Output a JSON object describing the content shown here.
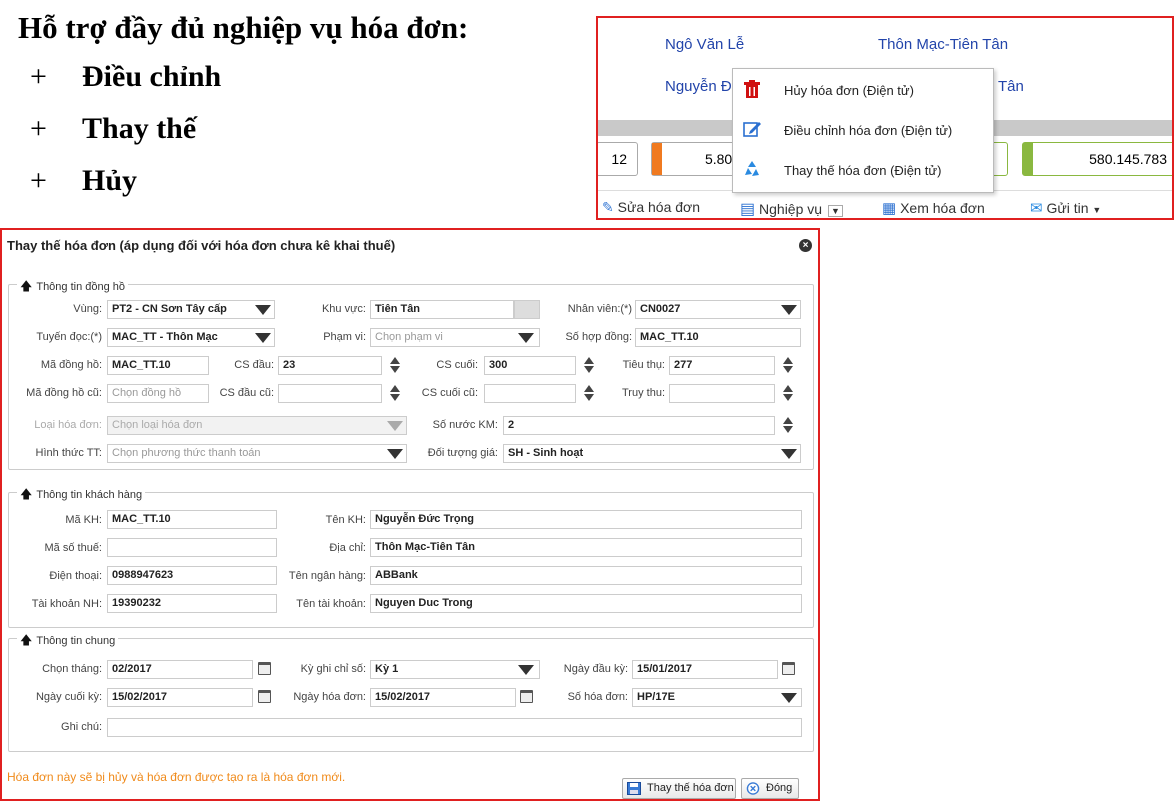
{
  "slide": {
    "heading": "Hỗ trợ đầy đủ nghiệp vụ hóa đơn:",
    "features": [
      "Điều chỉnh",
      "Thay thế",
      "Hủy"
    ],
    "bullet": "+"
  },
  "top_panel": {
    "row1_name": "Ngô Văn Lễ",
    "row1_address": "Thôn Mạc-Tiên Tân",
    "row2_name": "Nguyễn Đ",
    "row2_address": "Tân",
    "box1_value": "12",
    "box2_value": "5.801",
    "box3_value": "580.145.783",
    "toolbar": {
      "edit_label": "Sửa hóa đơn",
      "ops_label": "Nghiệp vụ",
      "view_label": "Xem hóa đơn",
      "send_label": "Gửi tin"
    },
    "menu": {
      "cancel": "Hủy hóa đơn (Điện tử)",
      "adjust": "Điều chỉnh hóa đơn (Điện tử)",
      "replace": "Thay thế hóa đơn (Điện tử)"
    }
  },
  "dialog": {
    "title": "Thay thế hóa đơn (áp dụng đối với hóa đơn chưa kê khai thuế)",
    "meter_section": {
      "legend": "Thông tin đồng hồ",
      "vung_label": "Vùng:",
      "vung_value": "PT2 - CN Sơn Tây cấp",
      "khuvuc_label": "Khu vực:",
      "khuvuc_value": "Tiên Tân",
      "nhanvien_label": "Nhân viên:(*)",
      "nhanvien_value": "CN0027",
      "tuyendoc_label": "Tuyến đọc:(*)",
      "tuyendoc_value": "MAC_TT - Thôn Mạc",
      "phamvi_label": "Phạm vi:",
      "phamvi_placeholder": "Chọn phạm vi",
      "sohopdong_label": "Số hợp đồng:",
      "sohopdong_value": "MAC_TT.10",
      "madongho_label": "Mã đồng hồ:",
      "madongho_value": "MAC_TT.10",
      "csdau_label": "CS đầu:",
      "csdau_value": "23",
      "cscuoi_label": "CS cuối:",
      "cscuoi_value": "300",
      "tieuthu_label": "Tiêu thụ:",
      "tieuthu_value": "277",
      "madonghocu_label": "Mã đồng hồ cũ:",
      "madonghocu_placeholder": "Chọn đồng hồ",
      "csdaucu_label": "CS đầu cũ:",
      "cscuoicu_label": "CS cuối cũ:",
      "truythu_label": "Truy thu:",
      "loaihoadon_label": "Loại hóa đơn:",
      "loaihoadon_placeholder": "Chọn loại hóa đơn",
      "sonuockm_label": "Số nước KM:",
      "sonuockm_value": "2",
      "hinhthuctt_label": "Hình thức TT:",
      "hinhthuctt_placeholder": "Chọn phương thức thanh toán",
      "doituonggia_label": "Đối tượng giá:",
      "doituonggia_value": "SH - Sinh hoạt"
    },
    "customer_section": {
      "legend": "Thông tin khách hàng",
      "makh_label": "Mã KH:",
      "makh_value": "MAC_TT.10",
      "tenkh_label": "Tên KH:",
      "tenkh_value": "Nguyễn Đức Trọng",
      "masothue_label": "Mã số thuế:",
      "diachi_label": "Địa chỉ:",
      "diachi_value": "Thôn Mạc-Tiên Tân",
      "dienthoai_label": "Điện thoại:",
      "dienthoai_value": "0988947623",
      "tennganhang_label": "Tên ngân hàng:",
      "tennganhang_value": "ABBank",
      "taikhoannh_label": "Tài khoản NH:",
      "taikhoannh_value": "19390232",
      "tentaikhoan_label": "Tên tài khoản:",
      "tentaikhoan_value": "Nguyen Duc Trong"
    },
    "general_section": {
      "legend": "Thông tin chung",
      "chonthang_label": "Chọn tháng:",
      "chonthang_value": "02/2017",
      "kyghichiso_label": "Kỳ ghi chỉ số:",
      "kyghichiso_value": "Kỳ 1",
      "ngaydauky_label": "Ngày đầu kỳ:",
      "ngaydauky_value": "15/01/2017",
      "ngaycuoiky_label": "Ngày cuối kỳ:",
      "ngaycuoiky_value": "15/02/2017",
      "ngayhoadon_label": "Ngày hóa đơn:",
      "ngayhoadon_value": "15/02/2017",
      "sohoadon_label": "Số hóa đơn:",
      "sohoadon_value": "HP/17E",
      "ghichu_label": "Ghi chú:"
    },
    "note": "Hóa đơn này sẽ bị hủy và hóa đơn được tạo ra là hóa đơn mới.",
    "replace_button": "Thay thế hóa đơn",
    "close_button": "Đóng"
  }
}
